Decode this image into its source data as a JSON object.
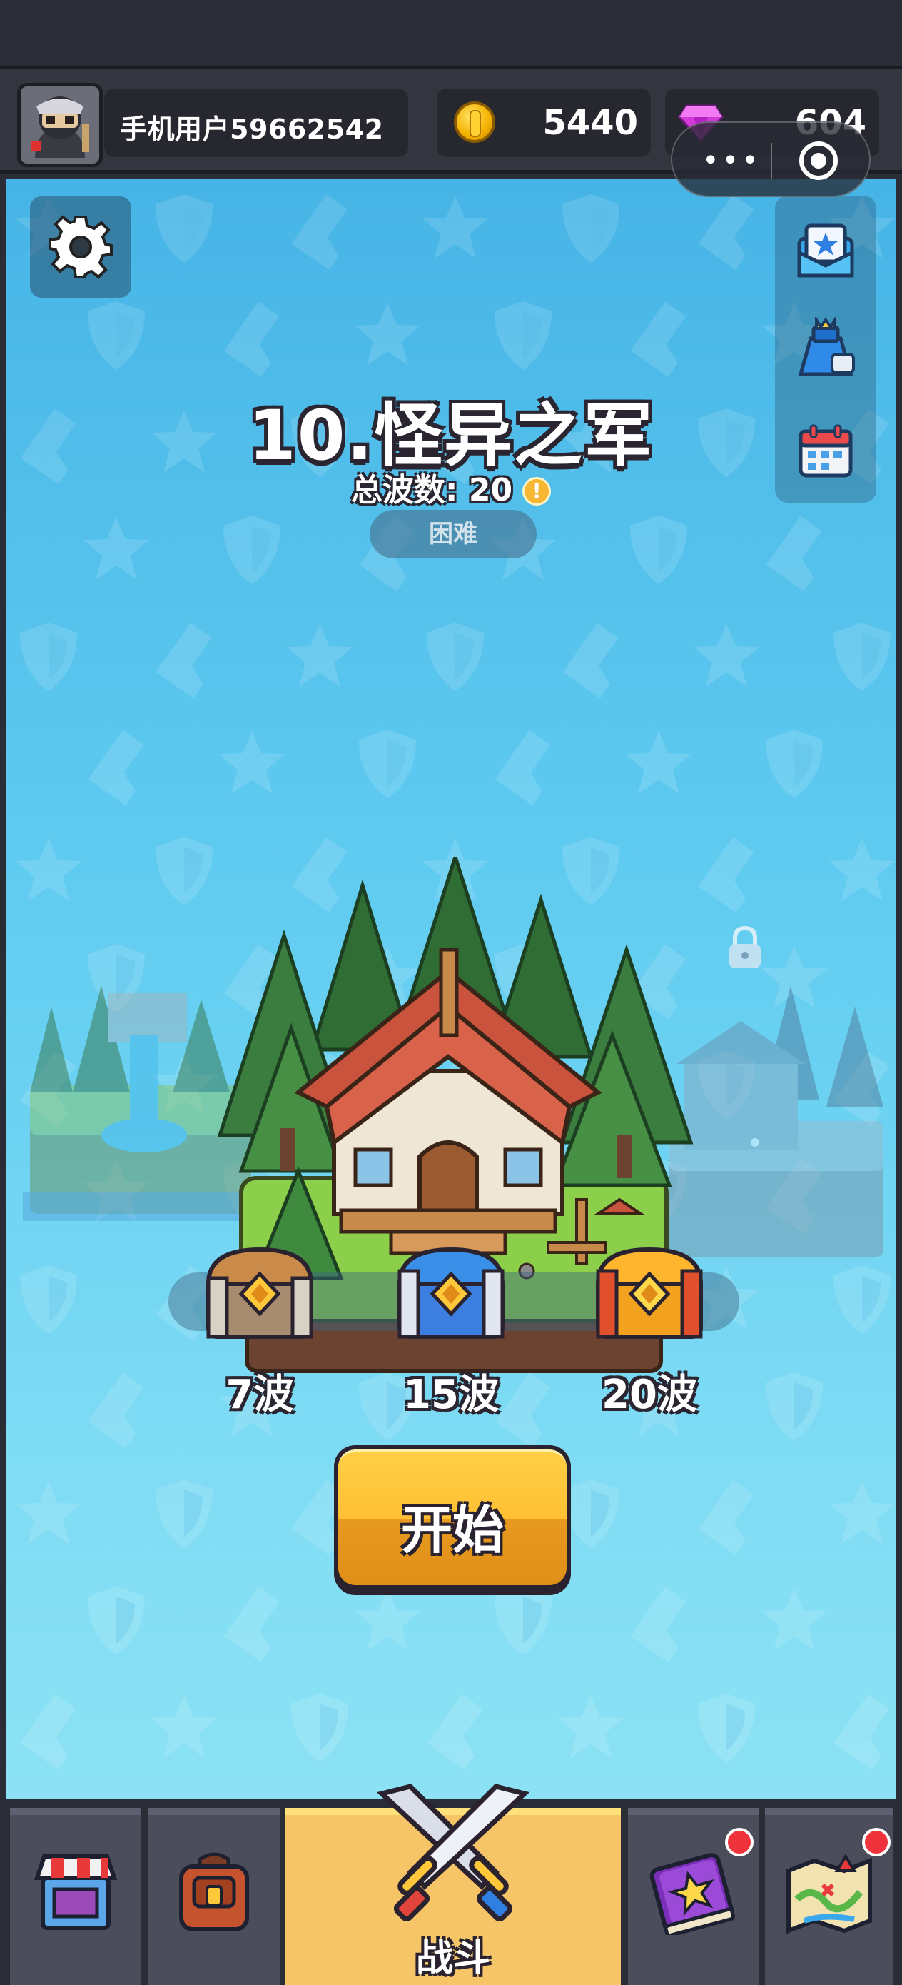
{
  "header": {
    "username": "手机用户59662542",
    "coins": "5440",
    "gems": "604"
  },
  "level": {
    "title": "10.怪异之军",
    "total_waves_label": "总波数: 20",
    "difficulty": "困难"
  },
  "rewards": [
    {
      "label": "7波",
      "chest": "bronze"
    },
    {
      "label": "15波",
      "chest": "silver-blue"
    },
    {
      "label": "20波",
      "chest": "gold"
    }
  ],
  "start_button": "开始",
  "nav": {
    "tabs": [
      {
        "name": "shop",
        "icon": "shop-icon"
      },
      {
        "name": "backpack",
        "icon": "backpack-icon"
      },
      {
        "name": "battle",
        "label": "战斗",
        "icon": "crossed-swords-icon",
        "active": true
      },
      {
        "name": "book",
        "icon": "book-icon",
        "badge": true
      },
      {
        "name": "map",
        "icon": "map-icon",
        "badge": true
      }
    ]
  },
  "colors": {
    "accent_yellow": "#ffc034",
    "badge_red": "#f0323c",
    "sky_blue": "#5ecaf0"
  }
}
